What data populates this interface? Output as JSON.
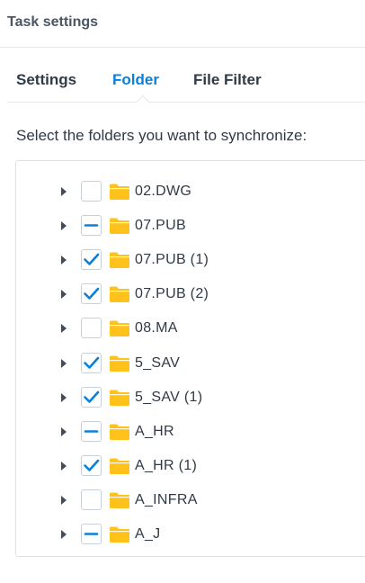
{
  "dialog": {
    "title": "Task settings"
  },
  "tabs": [
    {
      "label": "Settings",
      "active": false
    },
    {
      "label": "Folder",
      "active": true
    },
    {
      "label": "File Filter",
      "active": false
    }
  ],
  "instruction": "Select the folders you want to synchronize:",
  "colors": {
    "accent": "#0a80d8",
    "folder": "#ffc21a",
    "border": "#dfe3e8"
  },
  "folders": [
    {
      "name": "02.DWG",
      "state": "unchecked"
    },
    {
      "name": "07.PUB",
      "state": "partial"
    },
    {
      "name": "07.PUB (1)",
      "state": "checked"
    },
    {
      "name": "07.PUB (2)",
      "state": "checked"
    },
    {
      "name": "08.MA",
      "state": "unchecked"
    },
    {
      "name": "5_SAV",
      "state": "checked"
    },
    {
      "name": "5_SAV (1)",
      "state": "checked"
    },
    {
      "name": "A_HR",
      "state": "partial"
    },
    {
      "name": "A_HR (1)",
      "state": "checked"
    },
    {
      "name": "A_INFRA",
      "state": "unchecked"
    },
    {
      "name": "A_J",
      "state": "partial"
    }
  ]
}
